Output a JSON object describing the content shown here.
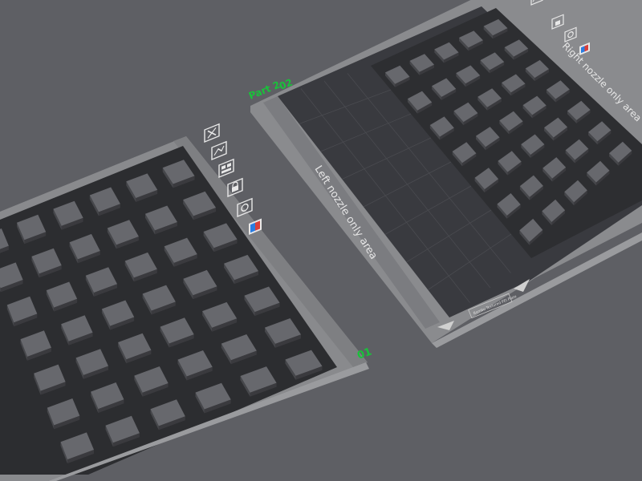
{
  "viewport": {
    "background": "#5e5f64",
    "plates": [
      {
        "id": "plate-1",
        "number_label": "01",
        "grid": {
          "rows": 7,
          "cols": 6
        },
        "toolbar_icons": [
          "close-icon",
          "auto-orient-icon",
          "arrange-icon",
          "lock-icon",
          "plate-settings-icon",
          "filament-map-icon"
        ]
      },
      {
        "id": "plate-2",
        "name_label": "Part 2",
        "number_label": "02",
        "left_nozzle_text": "Left nozzle only area",
        "right_nozzle_text": "Right nozzle only area",
        "bed_logo_text": "Bambu Textured PEI Plate",
        "grid": {
          "rows": 7,
          "cols": 5
        },
        "toolbar_icons": [
          "auto-orient-icon",
          "lock-icon",
          "plate-settings-icon",
          "filament-map-icon"
        ]
      }
    ],
    "colors": {
      "label_green": "#19c23a",
      "plate_base": "#8b8b8e",
      "plate_text": "#e6e6e6",
      "tile_top": "#67686d",
      "tile_side": "#3a3a3e",
      "tray": "#2f3033",
      "bed_dark": "#3a3b40"
    }
  }
}
